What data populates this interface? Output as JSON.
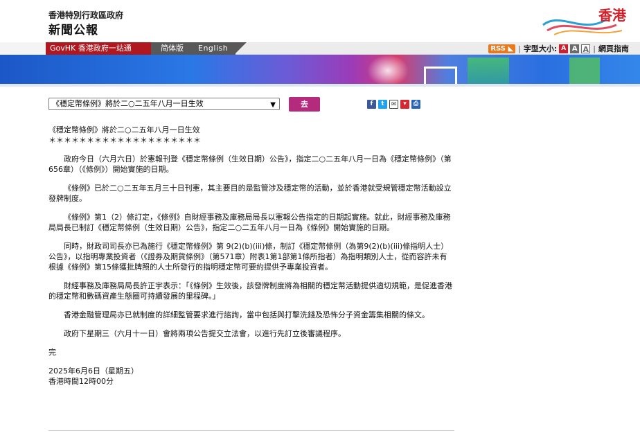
{
  "header": {
    "org_title": "香港特別行政區政府",
    "site_title": "新聞公報",
    "logo_text": "香港"
  },
  "nav": {
    "govhk": "GovHK 香港政府一站通",
    "simplified": "简体版",
    "english": "English"
  },
  "tools": {
    "rss": "RSS",
    "font_size_label": "字型大小:",
    "font_sizes": [
      "A",
      "A",
      "A"
    ],
    "sitemap": "網頁指南"
  },
  "toolbar": {
    "selected_article": "《穩定幣條例》將於二○二五年八月一日生效",
    "go_label": "去"
  },
  "share": {
    "icons": [
      "facebook-icon",
      "twitter-icon",
      "email-icon",
      "bookmark-icon",
      "print-icon"
    ],
    "colors": [
      "#3b5998",
      "#1da1f2",
      "#444444",
      "#d6262f",
      "#2a64b8"
    ]
  },
  "article": {
    "headline": "《穩定幣條例》將於二○二五年八月一日生效",
    "stars": "＊＊＊＊＊＊＊＊＊＊＊＊＊＊＊＊＊＊＊＊",
    "paragraphs": [
      "政府今日（六月六日）於憲報刊登《穩定幣條例（生效日期）公告》，指定二○二五年八月一日為《穩定幣條例》（第656章）（《條例》）開始實施的日期。",
      "《條例》已於二○二五年五月三十日刊憲，其主要目的是監管涉及穩定幣的活動，並於香港就受規管穩定幣活動設立發牌制度。",
      "《條例》第1（2）條訂定，《條例》自財經事務及庫務局局長以憲報公告指定的日期起實施。就此，財經事務及庫務局局長已制訂《穩定幣條例（生效日期）公告》，指定二○二五年八月一日為《條例》開始實施的日期。",
      "同時，財政司司長亦已為施行《穩定幣條例》第 9(2)(b)(iii)條，制訂《穩定幣條例（為第9(2)(b)(iii)條指明人士）公告》，以指明專業投資者（《證券及期貨條例》（第571章）附表1第1部第1條所指者）為指明類別人士，從而容許未有根據《條例》第15條獲批牌照的人士所發行的指明穩定幣可要約提供予專業投資者。",
      "財經事務及庫務局局長許正宇表示：「《條例》生效後，該發牌制度將為相關的穩定幣活動提供適切規範，是促進香港的穩定幣和數碼資產生態圈可持續發展的里程碑。」",
      "香港金融管理局亦已就制度的詳細監管要求進行諮詢，當中包括與打擊洗錢及恐怖分子資金籌集相關的條文。",
      "政府下星期三（六月十一日）會將兩項公告提交立法會，以進行先訂立後審議程序。"
    ],
    "end_mark": "完",
    "date": "2025年6月6日（星期五）",
    "time": "香港時間12時00分"
  }
}
